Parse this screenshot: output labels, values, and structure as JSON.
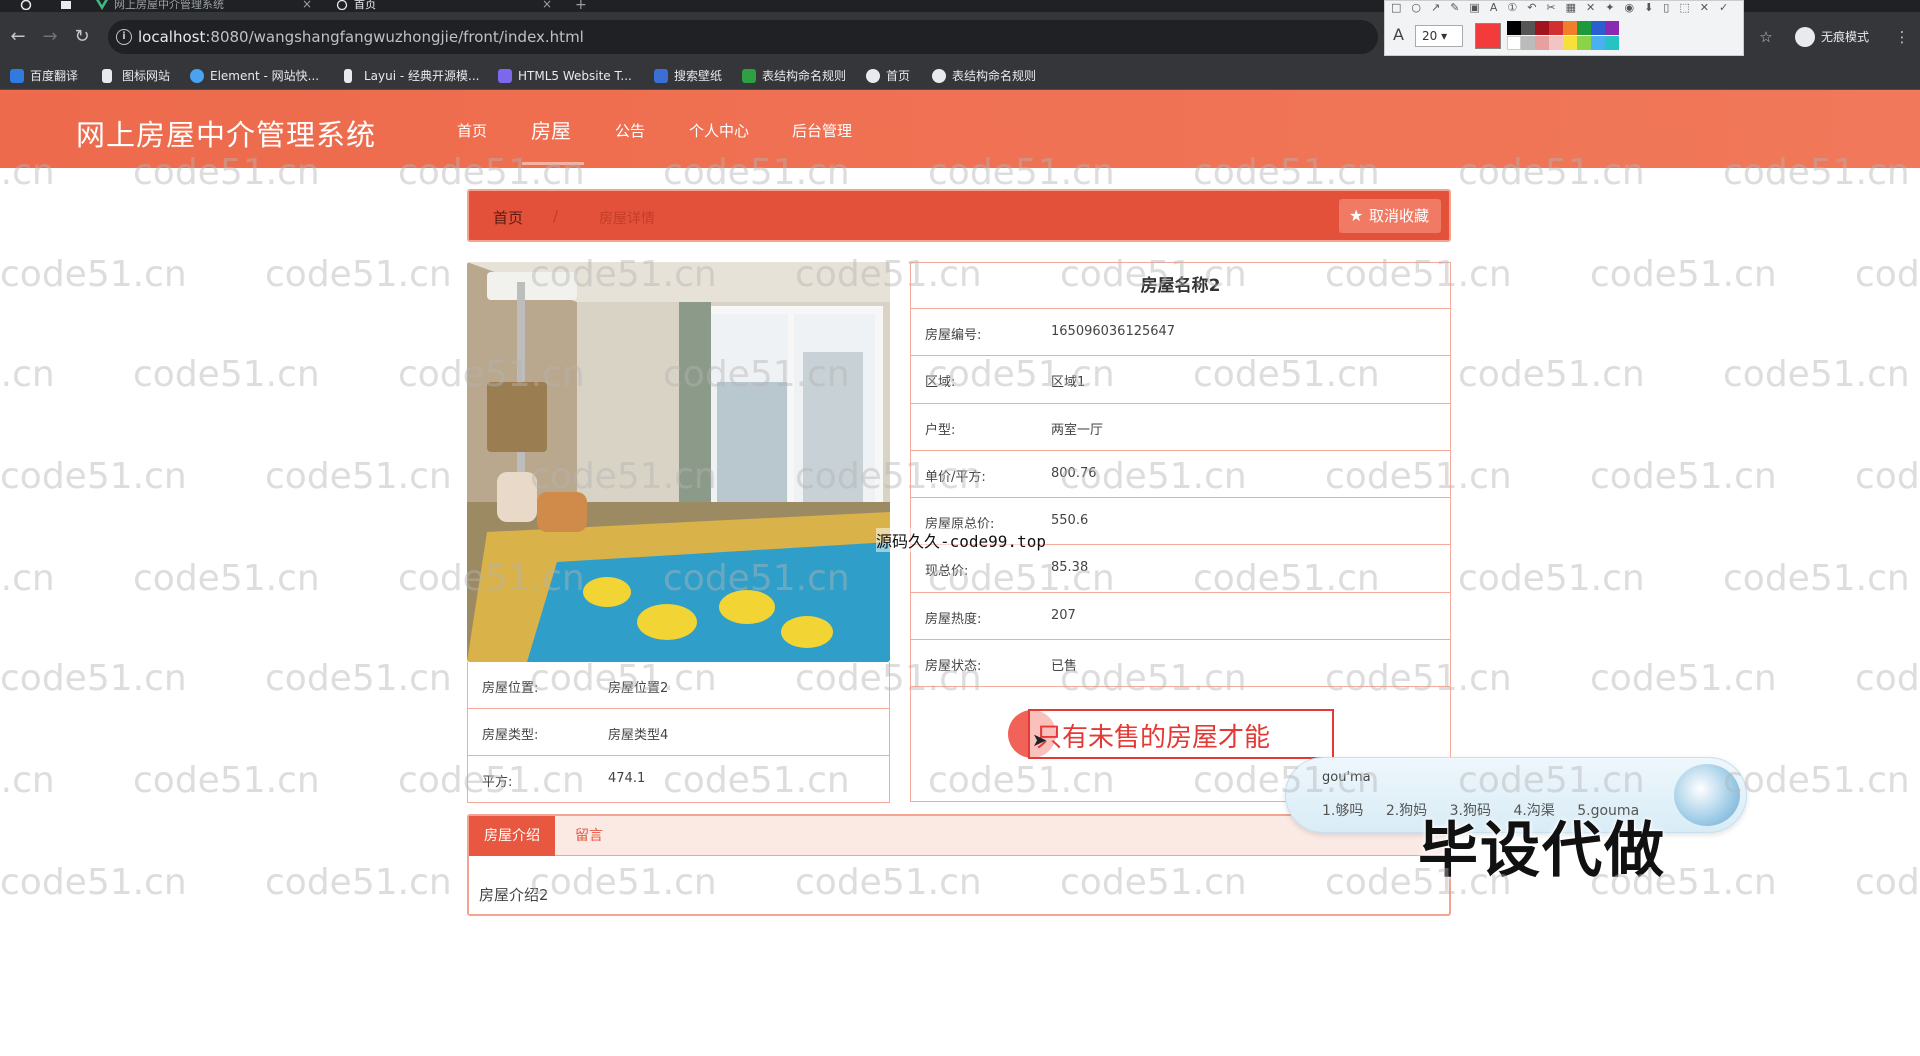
{
  "browser": {
    "tabs": [
      {
        "title": "网上房屋中介管理系统",
        "active": false
      },
      {
        "title": "首页",
        "active": true
      }
    ],
    "url_host": "localhost",
    "url_rest": ":8080/wangshangfangwuzhongjie/front/index.html",
    "incognito_label": "无痕模式",
    "bookmarks": [
      "百度翻译",
      "图标网站",
      "Element - 网站快...",
      "Layui - 经典开源模...",
      "HTML5 Website T...",
      "搜索壁纸",
      "表结构命名规则",
      "首页",
      "表结构命名规则"
    ],
    "drawing_toolbar": {
      "font_size": "20",
      "current_color": "#f33b3b"
    }
  },
  "site": {
    "title": "网上房屋中介管理系统",
    "nav": [
      "首页",
      "房屋",
      "公告",
      "个人中心",
      "后台管理"
    ],
    "active_nav": "房屋"
  },
  "breadcrumb": {
    "home": "首页",
    "separator": "/",
    "current": "房屋详情",
    "unfavorite_label": "取消收藏"
  },
  "house": {
    "name": "房屋名称2",
    "left_fields": [
      {
        "label": "房屋位置:",
        "value": "房屋位置2"
      },
      {
        "label": "房屋类型:",
        "value": "房屋类型4"
      },
      {
        "label": "平方:",
        "value": "474.1"
      }
    ],
    "right_fields": [
      {
        "label": "房屋编号:",
        "value": "165096036125647"
      },
      {
        "label": "区域:",
        "value": "区域1"
      },
      {
        "label": "户型:",
        "value": "两室一厅"
      },
      {
        "label": "单价/平方:",
        "value": "800.76"
      },
      {
        "label": "房屋原总价:",
        "value": "550.6"
      },
      {
        "label": "现总价:",
        "value": "85.38"
      },
      {
        "label": "房屋热度:",
        "value": "207"
      },
      {
        "label": "房屋状态:",
        "value": "已售"
      }
    ]
  },
  "detail_tabs": {
    "tabs": [
      "房屋介绍",
      "留言"
    ],
    "active": "房屋介绍",
    "content": "房屋介绍2"
  },
  "annotation": {
    "text": "只有未售的房屋才能"
  },
  "ime": {
    "input": "gou'ma",
    "candidates": [
      "1.够吗",
      "2.狗妈",
      "3.狗码",
      "4.沟渠",
      "5.gouma"
    ]
  },
  "overlays": {
    "source_site": "源码久久-code99.top",
    "big_text": "毕设代做"
  },
  "watermark_text": "code51.cn",
  "colors": {
    "primary": "#ee6a4c",
    "breadcrumb_bg": "#e4513a",
    "border": "#f4a99a"
  }
}
